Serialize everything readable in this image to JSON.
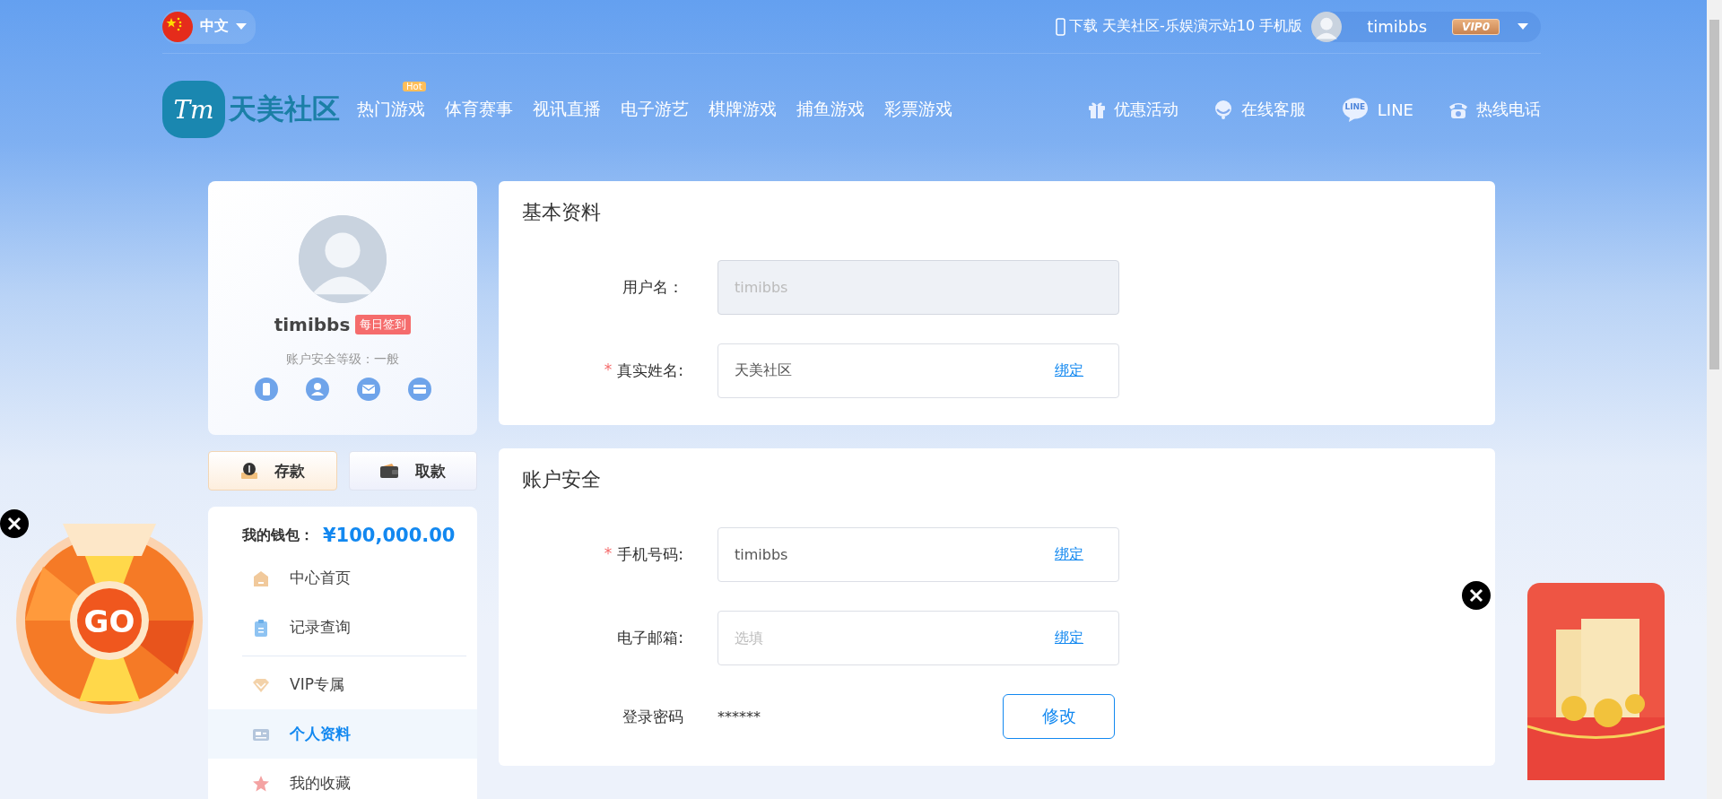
{
  "top_bar": {
    "language": "中文",
    "download": "下载 天美社区-乐娱演示站10 手机版",
    "username": "timibbs",
    "vip_badge": "VIP0"
  },
  "header": {
    "logo_mark": "Tm",
    "logo_text": "天美社区",
    "nav": [
      {
        "label": "热门游戏",
        "badge": "Hot"
      },
      {
        "label": "体育赛事"
      },
      {
        "label": "视讯直播"
      },
      {
        "label": "电子游艺"
      },
      {
        "label": "棋牌游戏"
      },
      {
        "label": "捕鱼游戏"
      },
      {
        "label": "彩票游戏"
      }
    ],
    "links": [
      {
        "label": "优惠活动"
      },
      {
        "label": "在线客服"
      },
      {
        "label": "LINE",
        "icon_text": "LINE"
      },
      {
        "label": "热线电话"
      }
    ]
  },
  "profile": {
    "username": "timibbs",
    "checkin_badge": "每日签到",
    "security_level": "账户安全等级：一般"
  },
  "actions": [
    {
      "label": "存款"
    },
    {
      "label": "取款"
    }
  ],
  "wallet": {
    "label": "我的钱包：",
    "amount": "¥100,000.00"
  },
  "menu_groups": [
    [
      {
        "label": "中心首页",
        "selected": false
      },
      {
        "label": "记录查询",
        "selected": false
      }
    ],
    [
      {
        "label": "VIP专属",
        "selected": false
      },
      {
        "label": "个人资料",
        "selected": true
      },
      {
        "label": "我的收藏",
        "selected": false
      }
    ]
  ],
  "sections": [
    {
      "title": "基本资料",
      "fields": [
        {
          "kind": "input",
          "label": "用户名：",
          "value": "timibbs",
          "disabled": true
        },
        {
          "kind": "input",
          "required_mark": "*",
          "label": "真实姓名:",
          "value": "天美社区",
          "disabled": false,
          "action": "绑定"
        }
      ]
    },
    {
      "title": "账户安全",
      "fields": [
        {
          "kind": "input",
          "required_mark": "*",
          "label": "手机号码:",
          "value": "timibbs",
          "disabled": false,
          "action": "绑定"
        },
        {
          "kind": "input",
          "label": "电子邮箱:",
          "placeholder": "选填",
          "disabled": false,
          "action": "绑定"
        },
        {
          "kind": "text",
          "label": "登录密码",
          "value": "******",
          "action": "修改"
        }
      ]
    }
  ],
  "promo": {
    "wheel_label": "GO"
  }
}
